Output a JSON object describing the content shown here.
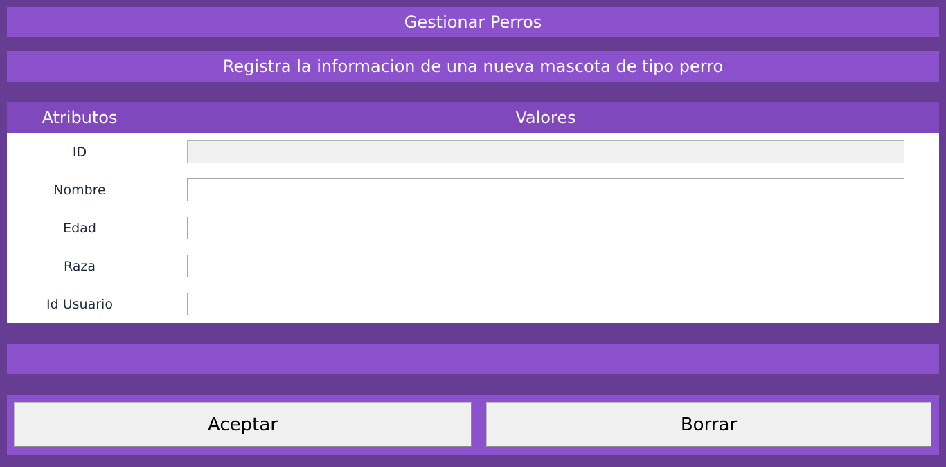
{
  "header": {
    "title": "Gestionar Perros",
    "subtitle": "Registra la informacion de una nueva mascota de tipo perro"
  },
  "table": {
    "col_attributes": "Atributos",
    "col_values": "Valores",
    "rows": [
      {
        "label": "ID",
        "value": "",
        "disabled": true
      },
      {
        "label": "Nombre",
        "value": ""
      },
      {
        "label": "Edad",
        "value": ""
      },
      {
        "label": "Raza",
        "value": ""
      },
      {
        "label": "Id Usuario",
        "value": ""
      }
    ]
  },
  "status": {
    "message": ""
  },
  "buttons": {
    "accept_label": "Aceptar",
    "clear_label": "Borrar"
  },
  "colors": {
    "background": "#673d94",
    "bar": "#8c51cd",
    "table_header": "#8048bd",
    "button_face": "#f0f0f0"
  }
}
